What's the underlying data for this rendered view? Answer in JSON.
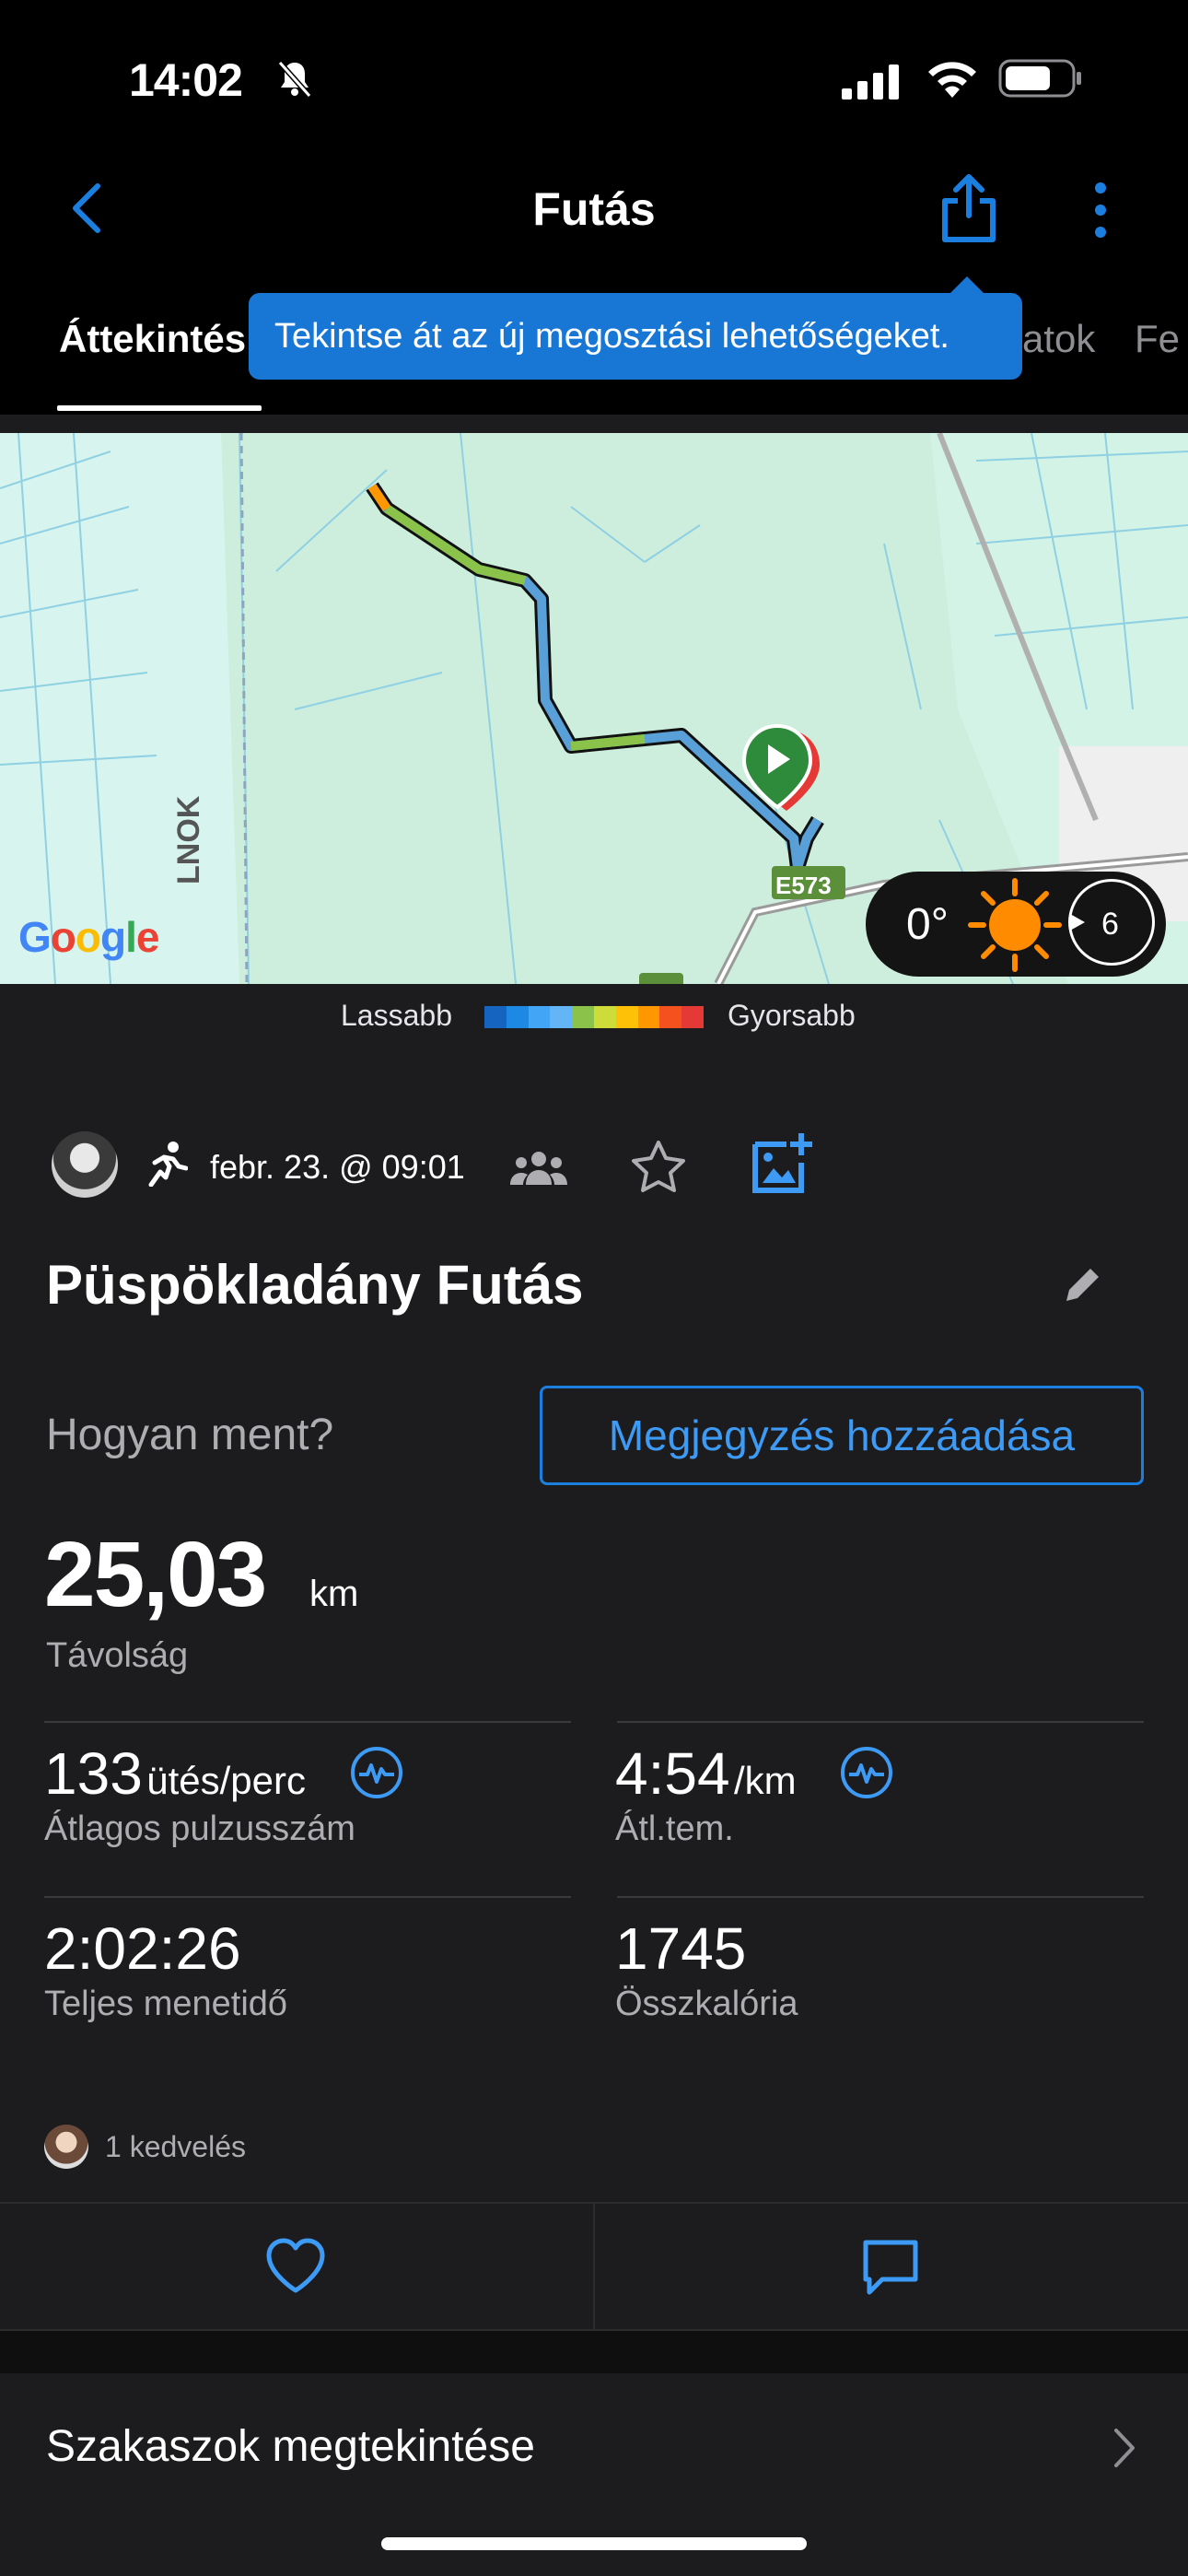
{
  "status": {
    "time": "14:02"
  },
  "header": {
    "title": "Futás"
  },
  "tabs": {
    "active": "Áttekintés",
    "t2": "atok",
    "t3": "Fe"
  },
  "tooltip": "Tekintse át az új megosztási lehetőségeket.",
  "map": {
    "google": "Google",
    "road_label": "E573",
    "side_label": "LNOK",
    "temp": "0°",
    "wind": "6"
  },
  "legend": {
    "slow": "Lassabb",
    "fast": "Gyorsabb",
    "colors": [
      "#1565c0",
      "#1e88e5",
      "#42a5f5",
      "#64b5f6",
      "#8bc34a",
      "#cddc39",
      "#ffc107",
      "#ff9800",
      "#f4511e",
      "#e53935"
    ]
  },
  "activity": {
    "date": "febr. 23. @ 09:01",
    "title": "Püspökladány Futás",
    "how_prompt": "Hogyan ment?",
    "note_button": "Megjegyzés hozzáadása"
  },
  "distance": {
    "value": "25,03",
    "unit": "km",
    "label": "Távolság"
  },
  "stats": [
    {
      "value": "133",
      "unit": "ütés/perc",
      "label": "Átlagos pulzusszám"
    },
    {
      "value": "4:54",
      "unit": "/km",
      "label": "Átl.tem."
    },
    {
      "value": "2:02:26",
      "unit": "",
      "label": "Teljes menetidő"
    },
    {
      "value": "1745",
      "unit": "",
      "label": "Összkalória"
    }
  ],
  "likes": "1 kedvelés",
  "segments": "Szakaszok megtekintése",
  "colors": {
    "accent": "#1b7fe0",
    "background": "#1c1c1e"
  }
}
